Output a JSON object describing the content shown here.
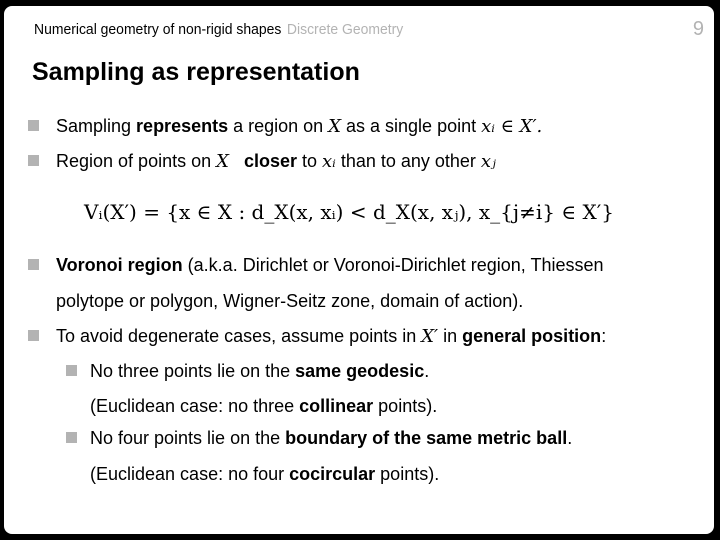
{
  "header": {
    "course": "Numerical geometry of non-rigid shapes",
    "section": "Discrete Geometry",
    "page": "9"
  },
  "title": "Sampling as representation",
  "colors": {
    "bullet": "#b3b3b3",
    "section": "#b3b3b3",
    "background": "#000000",
    "slide": "#ffffff"
  },
  "bullets": {
    "b1": {
      "t1": "Sampling ",
      "b1": "represents",
      "t2": " a region on ",
      "m1": "X",
      "t3": " as a single point ",
      "m2": "xᵢ ∈ X′."
    },
    "b2": {
      "t1": "Region of points on ",
      "m1": "X",
      "b1": "closer",
      "t2": " to ",
      "m2": "xᵢ",
      "t3": " than to any other ",
      "m3": "xⱼ"
    },
    "equation": "Vᵢ(X′)  =  {x ∈ X : d_X(x, xᵢ) < d_X(x, xⱼ), x_{j≠i} ∈ X′}",
    "b3": {
      "b1": "Voronoi region",
      "t1": " (a.k.a. Dirichlet or Voronoi-Dirichlet region, Thiessen",
      "t2": "polytope or polygon, Wigner-Seitz zone, domain of action)."
    },
    "b4": {
      "t1": "To avoid degenerate cases, assume points in ",
      "m1": "X′",
      "t2": " in ",
      "b1": "general position",
      "t3": ":"
    },
    "s1": {
      "t1": "No three points lie on the ",
      "b1": "same geodesic",
      "t2": ".",
      "t3": "(Euclidean case: no three ",
      "b2": "collinear",
      "t4": " points)."
    },
    "s2": {
      "t1": "No four points lie on the ",
      "b1": "boundary of the same metric ball",
      "t2": ".",
      "t3": "(Euclidean case: no four ",
      "b2": "cocircular",
      "t4": " points)."
    }
  }
}
